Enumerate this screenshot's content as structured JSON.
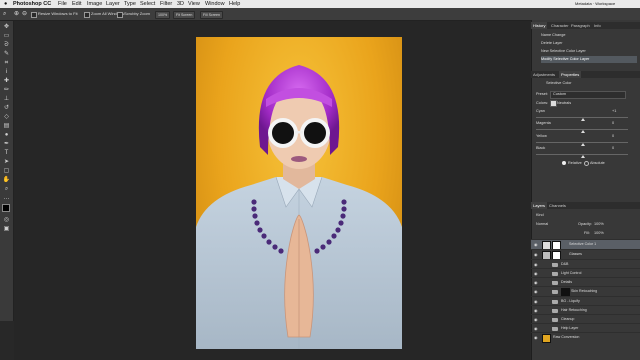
{
  "menubar": {
    "apple": "",
    "app": "Photoshop CC",
    "items": [
      "File",
      "Edit",
      "Image",
      "Layer",
      "Type",
      "Select",
      "Filter",
      "3D",
      "View",
      "Window",
      "Help"
    ],
    "right_status": "Metadata · Workspace"
  },
  "options": {
    "resize_windows": "Resize Windows to Fit",
    "zoom_all": "Zoom All Windows",
    "scrubby_zoom": "Scrubby Zoom",
    "zoom_value": "100%",
    "fit_screen": "Fit Screen",
    "fill_screen": "Fill Screen"
  },
  "history": {
    "tabs": [
      "History",
      "Character",
      "Paragraph",
      "Info"
    ],
    "items": [
      "Name Change",
      "Delete Layer",
      "New Selective Color Layer",
      "Modify Selective Color Layer"
    ],
    "selected_index": 3
  },
  "properties": {
    "tabs": [
      "Adjustments",
      "Properties"
    ],
    "title": "Selective Color",
    "preset_label": "Preset:",
    "preset_value": "Custom",
    "colors_label": "Colors:",
    "colors_value": "Neutrals",
    "sliders": [
      {
        "label": "Cyan",
        "value": "+1",
        "value_num": 1
      },
      {
        "label": "Magenta",
        "value": "0",
        "value_num": 0
      },
      {
        "label": "Yellow",
        "value": "0",
        "value_num": 0
      },
      {
        "label": "Black",
        "value": "0",
        "value_num": 0
      }
    ],
    "relative": "Relative",
    "absolute": "Absolute"
  },
  "layers": {
    "tabs": [
      "Layers",
      "Channels"
    ],
    "kind": "Kind",
    "blend_mode": "Normal",
    "opacity_label": "Opacity:",
    "opacity": "100%",
    "fill_label": "Fill:",
    "fill": "100%",
    "items": [
      {
        "name": "Selective Color 1",
        "type": "adjustment",
        "selected": true
      },
      {
        "name": "Glasses",
        "type": "layer",
        "selected": false
      },
      {
        "name": "D&B",
        "type": "folder",
        "selected": false
      },
      {
        "name": "Light Control",
        "type": "folder",
        "selected": false
      },
      {
        "name": "Details",
        "type": "folder",
        "selected": false
      },
      {
        "name": "Skin Retouching",
        "type": "folder",
        "selected": false
      },
      {
        "name": "BG - Liquify",
        "type": "folder",
        "selected": false
      },
      {
        "name": "Hair Retouching",
        "type": "folder",
        "selected": false
      },
      {
        "name": "Cleanup",
        "type": "folder",
        "selected": false
      },
      {
        "name": "Help Layer",
        "type": "folder",
        "selected": false
      },
      {
        "name": "Raw Conversion",
        "type": "layer",
        "selected": false
      }
    ]
  },
  "watermark": "udemy",
  "colors": {
    "menu": "#e9e9e9",
    "panel": "#383838",
    "canvas": "#262626",
    "bg_yellow": "#eaa41c",
    "hair": "#b03ad0"
  }
}
